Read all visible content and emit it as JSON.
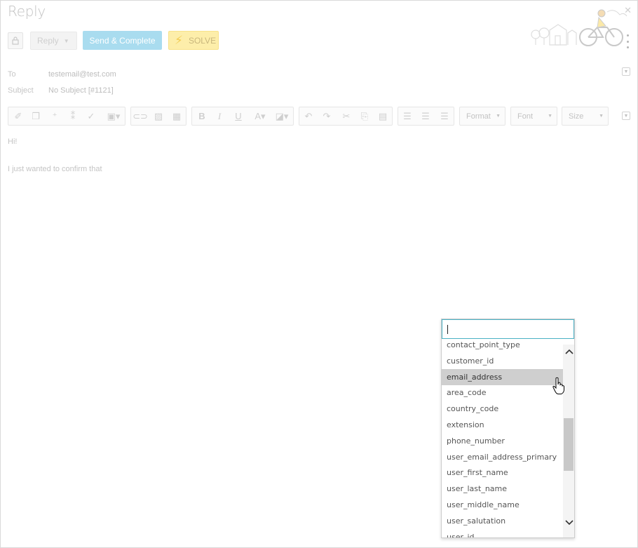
{
  "header": {
    "title": "Reply",
    "reply_label": "Reply",
    "send_complete_label": "Send & Complete",
    "solve_label": "SOLVE",
    "close_glyph": "✕"
  },
  "fields": {
    "to_label": "To",
    "to_value": "testemail@test.com",
    "subject_label": "Subject",
    "subject_value": "No Subject [#1121]"
  },
  "toolbar": {
    "format_label": "Format",
    "font_label": "Font",
    "size_label": "Size",
    "icons": [
      "eraser-icon",
      "copy-format-icon",
      "add-field-icon",
      "insert-field-icon",
      "spellcheck-icon",
      "paste-icon",
      "link-icon",
      "image-icon",
      "table-icon",
      "bold-icon",
      "italic-icon",
      "underline-icon",
      "text-color-icon",
      "background-color-icon",
      "undo-icon",
      "redo-icon",
      "cut-icon",
      "copy-icon",
      "paste-text-icon",
      "align-left-icon",
      "align-center-icon",
      "align-right-icon"
    ]
  },
  "editor": {
    "line1": "Hi!",
    "line2": "I just wanted to confirm that"
  },
  "dropdown": {
    "search_value": "",
    "items": [
      "contact_point_type",
      "customer_id",
      "email_address",
      "area_code",
      "country_code",
      "extension",
      "phone_number",
      "user_email_address_primary",
      "user_first_name",
      "user_last_name",
      "user_middle_name",
      "user_salutation",
      "user_id"
    ],
    "hovered_index": 2
  },
  "colors": {
    "send_button": "#a9dcef",
    "solve_button": "#fdeeaa",
    "input_focus": "#4ab1c4",
    "hover_item": "#cfcfcf"
  }
}
